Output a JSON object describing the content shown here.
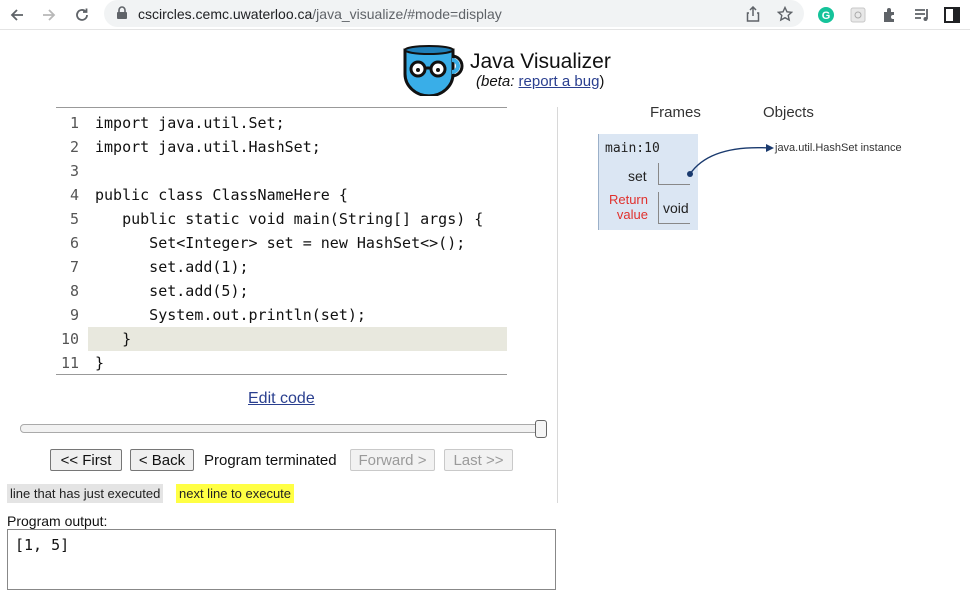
{
  "browser": {
    "url_host": "cscircles.cemc.uwaterloo.ca",
    "url_path": "/java_visualize/#mode=display"
  },
  "header": {
    "title": "Java Visualizer",
    "beta_prefix": "(beta: ",
    "report_link": "report a bug",
    "beta_suffix": ")"
  },
  "code": {
    "lines": [
      {
        "num": "1",
        "text": "import java.util.Set;"
      },
      {
        "num": "2",
        "text": "import java.util.HashSet;"
      },
      {
        "num": "3",
        "text": ""
      },
      {
        "num": "4",
        "text": "public class ClassNameHere {"
      },
      {
        "num": "5",
        "text": "   public static void main(String[] args) {"
      },
      {
        "num": "6",
        "text": "      Set<Integer> set = new HashSet<>();"
      },
      {
        "num": "7",
        "text": "      set.add(1);"
      },
      {
        "num": "8",
        "text": "      set.add(5);"
      },
      {
        "num": "9",
        "text": "      System.out.println(set);"
      },
      {
        "num": "10",
        "text": "   }"
      },
      {
        "num": "11",
        "text": "}"
      }
    ],
    "highlighted_line": 10
  },
  "edit_code": "Edit code",
  "slider": {
    "position": 1.0
  },
  "controls": {
    "first": "<< First",
    "back": "< Back",
    "status": "Program terminated",
    "forward": "Forward >",
    "last": "Last >>"
  },
  "legend": {
    "executed": "line that has just executed",
    "next": "next line to execute"
  },
  "output": {
    "label": "Program output:",
    "text": "[1, 5]"
  },
  "visualization": {
    "frames_header": "Frames",
    "objects_header": "Objects",
    "frame_name": "main:10",
    "var_name": "set",
    "return_label_1": "Return",
    "return_label_2": "value",
    "return_value": "void",
    "heap_object": "java.util.HashSet instance"
  },
  "colors": {
    "highlight_executed": "#e8e8de",
    "highlight_next": "#ffff44",
    "frame_bg": "#dbe6f3",
    "return_label": "#e0312d",
    "link": "#2a3f8f"
  }
}
